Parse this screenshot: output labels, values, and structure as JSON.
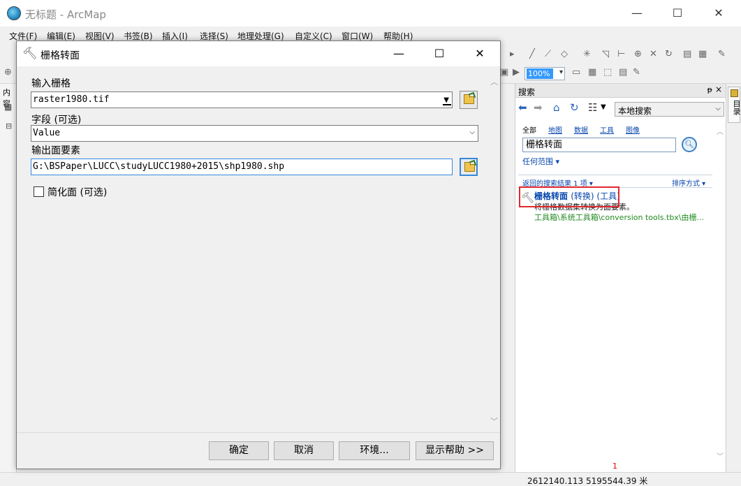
{
  "app": {
    "title": "无标题 - ArcMap"
  },
  "menubar": [
    "文件(F)",
    "编辑(E)",
    "视图(V)",
    "书签(B)",
    "插入(I)",
    "选择(S)",
    "地理处理(G)",
    "自定义(C)",
    "窗口(W)",
    "帮助(H)"
  ],
  "toolbar": {
    "zoom_value": "100%"
  },
  "left_panel": {
    "label": "内容"
  },
  "dialog": {
    "title": "栅格转面",
    "fields": {
      "input_raster_label": "输入栅格",
      "input_raster_value": "raster1980.tif",
      "field_label": "字段 (可选)",
      "field_value": "Value",
      "output_label": "输出面要素",
      "output_value": "G:\\BSPaper\\LUCC\\studyLUCC1980+2015\\shp1980.shp",
      "simplify_label": "简化面 (可选)"
    },
    "buttons": {
      "ok": "确定",
      "cancel": "取消",
      "env": "环境...",
      "help": "显示帮助 >>"
    }
  },
  "search": {
    "title": "搜索",
    "location": "本地搜索",
    "tabs": [
      "全部",
      "地图",
      "数据",
      "工具",
      "图像"
    ],
    "query": "栅格转面",
    "scope": "任何范围",
    "result_count": "返回的搜索结果 1 项",
    "sort": "排序方式",
    "result": {
      "title": "栅格转面",
      "title_suffix": "(转换) (工具)",
      "description": "将栅格数据集转换为面要素。",
      "path": "工具箱\\系统工具箱\\conversion tools.tbx\\由栅..."
    },
    "page_marker": "1"
  },
  "right_strip": {
    "tab": "目录"
  },
  "status": {
    "coords": "2612140.113  5195544.39 米"
  },
  "colors": {
    "accent": "#3388dd",
    "highlight": "#e0282e",
    "link": "#0645ad",
    "path": "#228b22"
  }
}
